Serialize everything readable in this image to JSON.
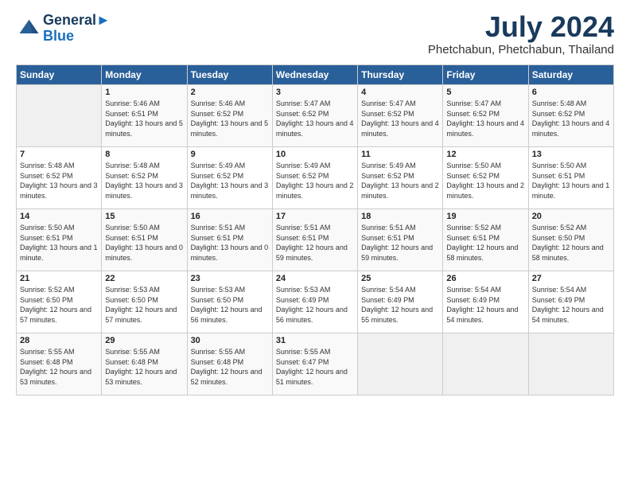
{
  "header": {
    "logo_line1": "General",
    "logo_line2": "Blue",
    "month": "July 2024",
    "location": "Phetchabun, Phetchabun, Thailand"
  },
  "days_of_week": [
    "Sunday",
    "Monday",
    "Tuesday",
    "Wednesday",
    "Thursday",
    "Friday",
    "Saturday"
  ],
  "weeks": [
    [
      {
        "day": "",
        "empty": true
      },
      {
        "day": "1",
        "sunrise": "5:46 AM",
        "sunset": "6:51 PM",
        "daylight": "13 hours and 5 minutes."
      },
      {
        "day": "2",
        "sunrise": "5:46 AM",
        "sunset": "6:52 PM",
        "daylight": "13 hours and 5 minutes."
      },
      {
        "day": "3",
        "sunrise": "5:47 AM",
        "sunset": "6:52 PM",
        "daylight": "13 hours and 4 minutes."
      },
      {
        "day": "4",
        "sunrise": "5:47 AM",
        "sunset": "6:52 PM",
        "daylight": "13 hours and 4 minutes."
      },
      {
        "day": "5",
        "sunrise": "5:47 AM",
        "sunset": "6:52 PM",
        "daylight": "13 hours and 4 minutes."
      },
      {
        "day": "6",
        "sunrise": "5:48 AM",
        "sunset": "6:52 PM",
        "daylight": "13 hours and 4 minutes."
      }
    ],
    [
      {
        "day": "7",
        "sunrise": "5:48 AM",
        "sunset": "6:52 PM",
        "daylight": "13 hours and 3 minutes."
      },
      {
        "day": "8",
        "sunrise": "5:48 AM",
        "sunset": "6:52 PM",
        "daylight": "13 hours and 3 minutes."
      },
      {
        "day": "9",
        "sunrise": "5:49 AM",
        "sunset": "6:52 PM",
        "daylight": "13 hours and 3 minutes."
      },
      {
        "day": "10",
        "sunrise": "5:49 AM",
        "sunset": "6:52 PM",
        "daylight": "13 hours and 2 minutes."
      },
      {
        "day": "11",
        "sunrise": "5:49 AM",
        "sunset": "6:52 PM",
        "daylight": "13 hours and 2 minutes."
      },
      {
        "day": "12",
        "sunrise": "5:50 AM",
        "sunset": "6:52 PM",
        "daylight": "13 hours and 2 minutes."
      },
      {
        "day": "13",
        "sunrise": "5:50 AM",
        "sunset": "6:51 PM",
        "daylight": "13 hours and 1 minute."
      }
    ],
    [
      {
        "day": "14",
        "sunrise": "5:50 AM",
        "sunset": "6:51 PM",
        "daylight": "13 hours and 1 minute."
      },
      {
        "day": "15",
        "sunrise": "5:50 AM",
        "sunset": "6:51 PM",
        "daylight": "13 hours and 0 minutes."
      },
      {
        "day": "16",
        "sunrise": "5:51 AM",
        "sunset": "6:51 PM",
        "daylight": "13 hours and 0 minutes."
      },
      {
        "day": "17",
        "sunrise": "5:51 AM",
        "sunset": "6:51 PM",
        "daylight": "12 hours and 59 minutes."
      },
      {
        "day": "18",
        "sunrise": "5:51 AM",
        "sunset": "6:51 PM",
        "daylight": "12 hours and 59 minutes."
      },
      {
        "day": "19",
        "sunrise": "5:52 AM",
        "sunset": "6:51 PM",
        "daylight": "12 hours and 58 minutes."
      },
      {
        "day": "20",
        "sunrise": "5:52 AM",
        "sunset": "6:50 PM",
        "daylight": "12 hours and 58 minutes."
      }
    ],
    [
      {
        "day": "21",
        "sunrise": "5:52 AM",
        "sunset": "6:50 PM",
        "daylight": "12 hours and 57 minutes."
      },
      {
        "day": "22",
        "sunrise": "5:53 AM",
        "sunset": "6:50 PM",
        "daylight": "12 hours and 57 minutes."
      },
      {
        "day": "23",
        "sunrise": "5:53 AM",
        "sunset": "6:50 PM",
        "daylight": "12 hours and 56 minutes."
      },
      {
        "day": "24",
        "sunrise": "5:53 AM",
        "sunset": "6:49 PM",
        "daylight": "12 hours and 56 minutes."
      },
      {
        "day": "25",
        "sunrise": "5:54 AM",
        "sunset": "6:49 PM",
        "daylight": "12 hours and 55 minutes."
      },
      {
        "day": "26",
        "sunrise": "5:54 AM",
        "sunset": "6:49 PM",
        "daylight": "12 hours and 54 minutes."
      },
      {
        "day": "27",
        "sunrise": "5:54 AM",
        "sunset": "6:49 PM",
        "daylight": "12 hours and 54 minutes."
      }
    ],
    [
      {
        "day": "28",
        "sunrise": "5:55 AM",
        "sunset": "6:48 PM",
        "daylight": "12 hours and 53 minutes."
      },
      {
        "day": "29",
        "sunrise": "5:55 AM",
        "sunset": "6:48 PM",
        "daylight": "12 hours and 53 minutes."
      },
      {
        "day": "30",
        "sunrise": "5:55 AM",
        "sunset": "6:48 PM",
        "daylight": "12 hours and 52 minutes."
      },
      {
        "day": "31",
        "sunrise": "5:55 AM",
        "sunset": "6:47 PM",
        "daylight": "12 hours and 51 minutes."
      },
      {
        "day": "",
        "empty": true
      },
      {
        "day": "",
        "empty": true
      },
      {
        "day": "",
        "empty": true
      }
    ]
  ]
}
